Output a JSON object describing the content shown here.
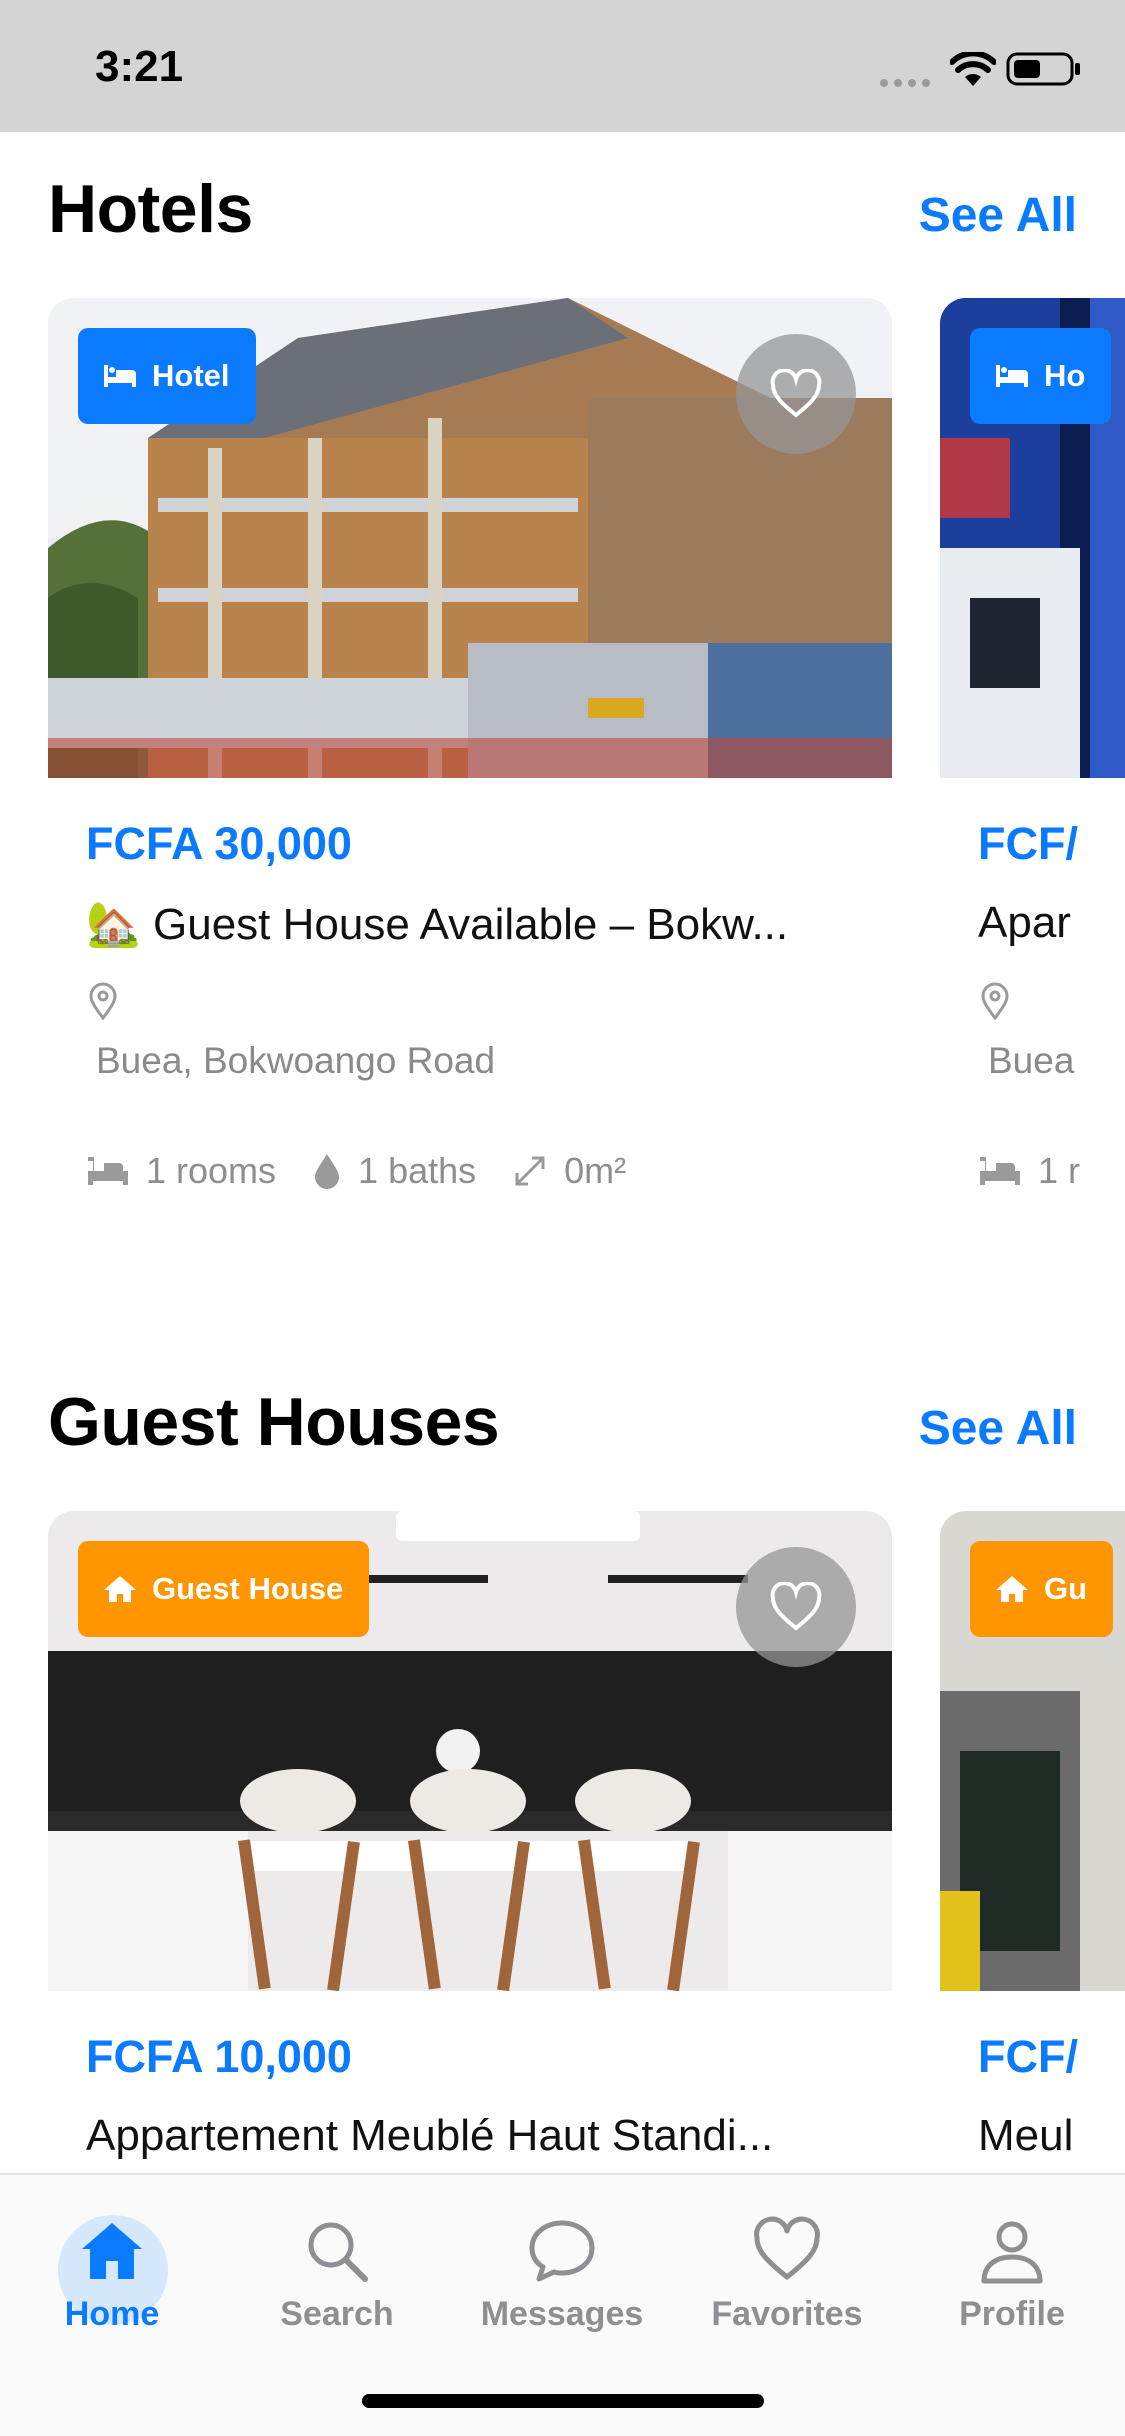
{
  "status_bar": {
    "time": "3:21"
  },
  "sections": [
    {
      "title": "Hotels",
      "see_all": "See All",
      "cards": [
        {
          "badge": "Hotel",
          "badge_color": "#0a7aff",
          "price": "FCFA 30,000",
          "title": "🏡 Guest House Available – Bokw...",
          "location": "Buea, Bokwoango Road",
          "rooms": "1 rooms",
          "baths": "1 baths",
          "area": "0m²"
        },
        {
          "badge": "Ho",
          "price": "FCF/",
          "title": "Apar",
          "location": "Buea",
          "rooms": "1 r"
        }
      ]
    },
    {
      "title": "Guest Houses",
      "see_all": "See All",
      "cards": [
        {
          "badge": "Guest House",
          "badge_color": "#ff9500",
          "price": "FCFA 10,000",
          "title": "Appartement Meublé Haut Standi..."
        },
        {
          "badge": "Gu",
          "price": "FCF/",
          "title": "Meul"
        }
      ]
    }
  ],
  "tabs": [
    {
      "label": "Home",
      "icon": "home-icon",
      "active": true
    },
    {
      "label": "Search",
      "icon": "search-icon"
    },
    {
      "label": "Messages",
      "icon": "chat-bubble-icon"
    },
    {
      "label": "Favorites",
      "icon": "heart-icon"
    },
    {
      "label": "Profile",
      "icon": "person-icon"
    }
  ],
  "colors": {
    "accent": "#0a7aff",
    "orange": "#ff9500"
  }
}
